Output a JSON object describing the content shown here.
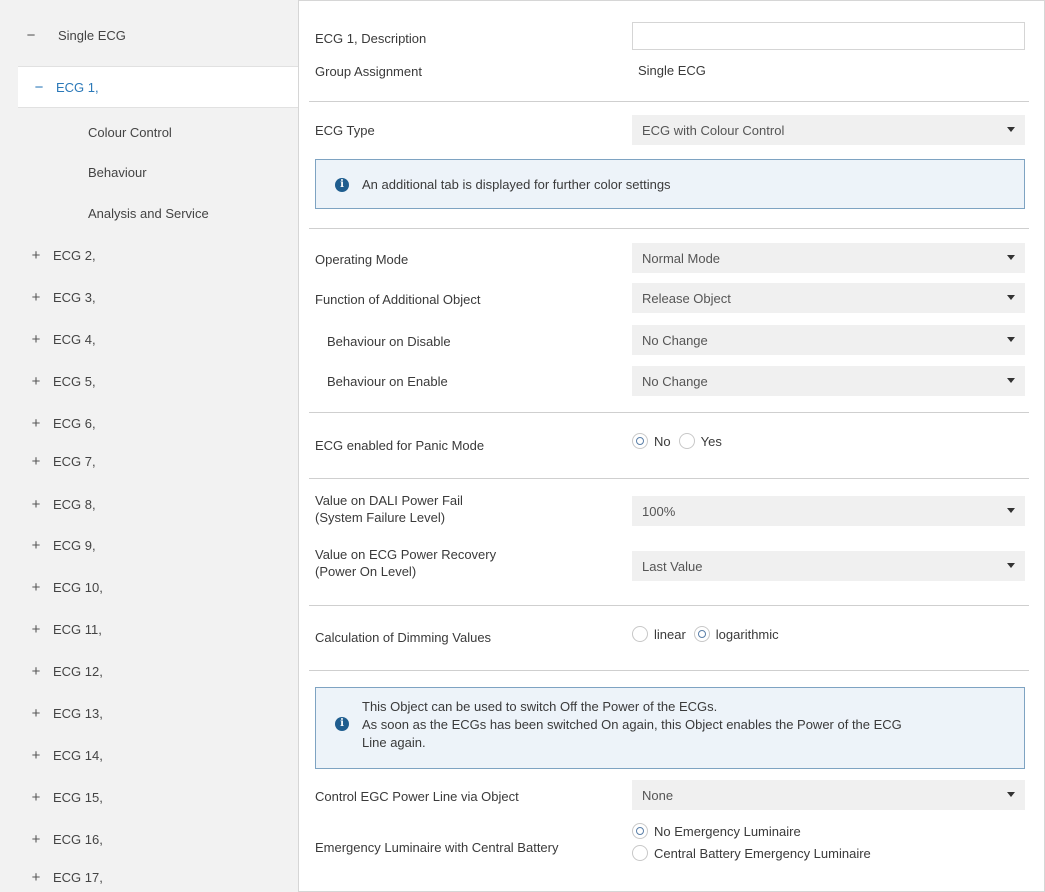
{
  "sidebar": {
    "top_item": {
      "sign": "−",
      "label": "Single ECG"
    },
    "selected_item": {
      "sign": "−",
      "label": "ECG 1,"
    },
    "sub_items": [
      "Colour Control",
      "Behaviour",
      "Analysis and Service"
    ],
    "ecg_items": [
      {
        "sign": "+",
        "label": "ECG 2,"
      },
      {
        "sign": "+",
        "label": "ECG 3,"
      },
      {
        "sign": "+",
        "label": "ECG 4,"
      },
      {
        "sign": "+",
        "label": "ECG 5,"
      },
      {
        "sign": "+",
        "label": "ECG 6,"
      },
      {
        "sign": "+",
        "label": "ECG 7,"
      },
      {
        "sign": "+",
        "label": "ECG 8,"
      },
      {
        "sign": "+",
        "label": "ECG 9,"
      },
      {
        "sign": "+",
        "label": "ECG 10,"
      },
      {
        "sign": "+",
        "label": "ECG 11,"
      },
      {
        "sign": "+",
        "label": "ECG 12,"
      },
      {
        "sign": "+",
        "label": "ECG 13,"
      },
      {
        "sign": "+",
        "label": "ECG 14,"
      },
      {
        "sign": "+",
        "label": "ECG 15,"
      },
      {
        "sign": "+",
        "label": "ECG 16,"
      },
      {
        "sign": "+",
        "label": "ECG 17,"
      }
    ]
  },
  "main": {
    "description_label": "ECG 1, Description",
    "description_value": "",
    "group_assignment_label": "Group Assignment",
    "group_assignment_value": "Single ECG",
    "ecg_type_label": "ECG Type",
    "ecg_type_value": "ECG with Colour Control",
    "info1": "An additional tab is displayed for further color settings",
    "operating_mode_label": "Operating Mode",
    "operating_mode_value": "Normal Mode",
    "additional_object_label": "Function of Additional Object",
    "additional_object_value": "Release Object",
    "behaviour_disable_label": "Behaviour on Disable",
    "behaviour_disable_value": "No Change",
    "behaviour_enable_label": "Behaviour on Enable",
    "behaviour_enable_value": "No Change",
    "panic_label": "ECG enabled for Panic Mode",
    "panic_options": [
      "No",
      "Yes"
    ],
    "panic_selected": "No",
    "dali_fail_label_1": "Value on DALI Power Fail",
    "dali_fail_label_2": "(System Failure Level)",
    "dali_fail_value": "100%",
    "recovery_label_1": "Value on ECG Power Recovery",
    "recovery_label_2": "(Power On Level)",
    "recovery_value": "Last Value",
    "dimming_label": "Calculation of Dimming Values",
    "dimming_options": [
      "linear",
      "logarithmic"
    ],
    "dimming_selected": "logarithmic",
    "info2_line1": "This Object can be used to switch Off the Power of the ECGs.",
    "info2_line2": "As soon as the ECGs has been switched On again, this Object enables the Power of the ECG",
    "info2_line3": "Line again.",
    "power_line_label": "Control EGC Power Line via Object",
    "power_line_value": "None",
    "emergency_label": "Emergency Luminaire with Central Battery",
    "emergency_options": [
      "No Emergency Luminaire",
      "Central Battery Emergency Luminaire"
    ],
    "emergency_selected": "No Emergency Luminaire"
  }
}
